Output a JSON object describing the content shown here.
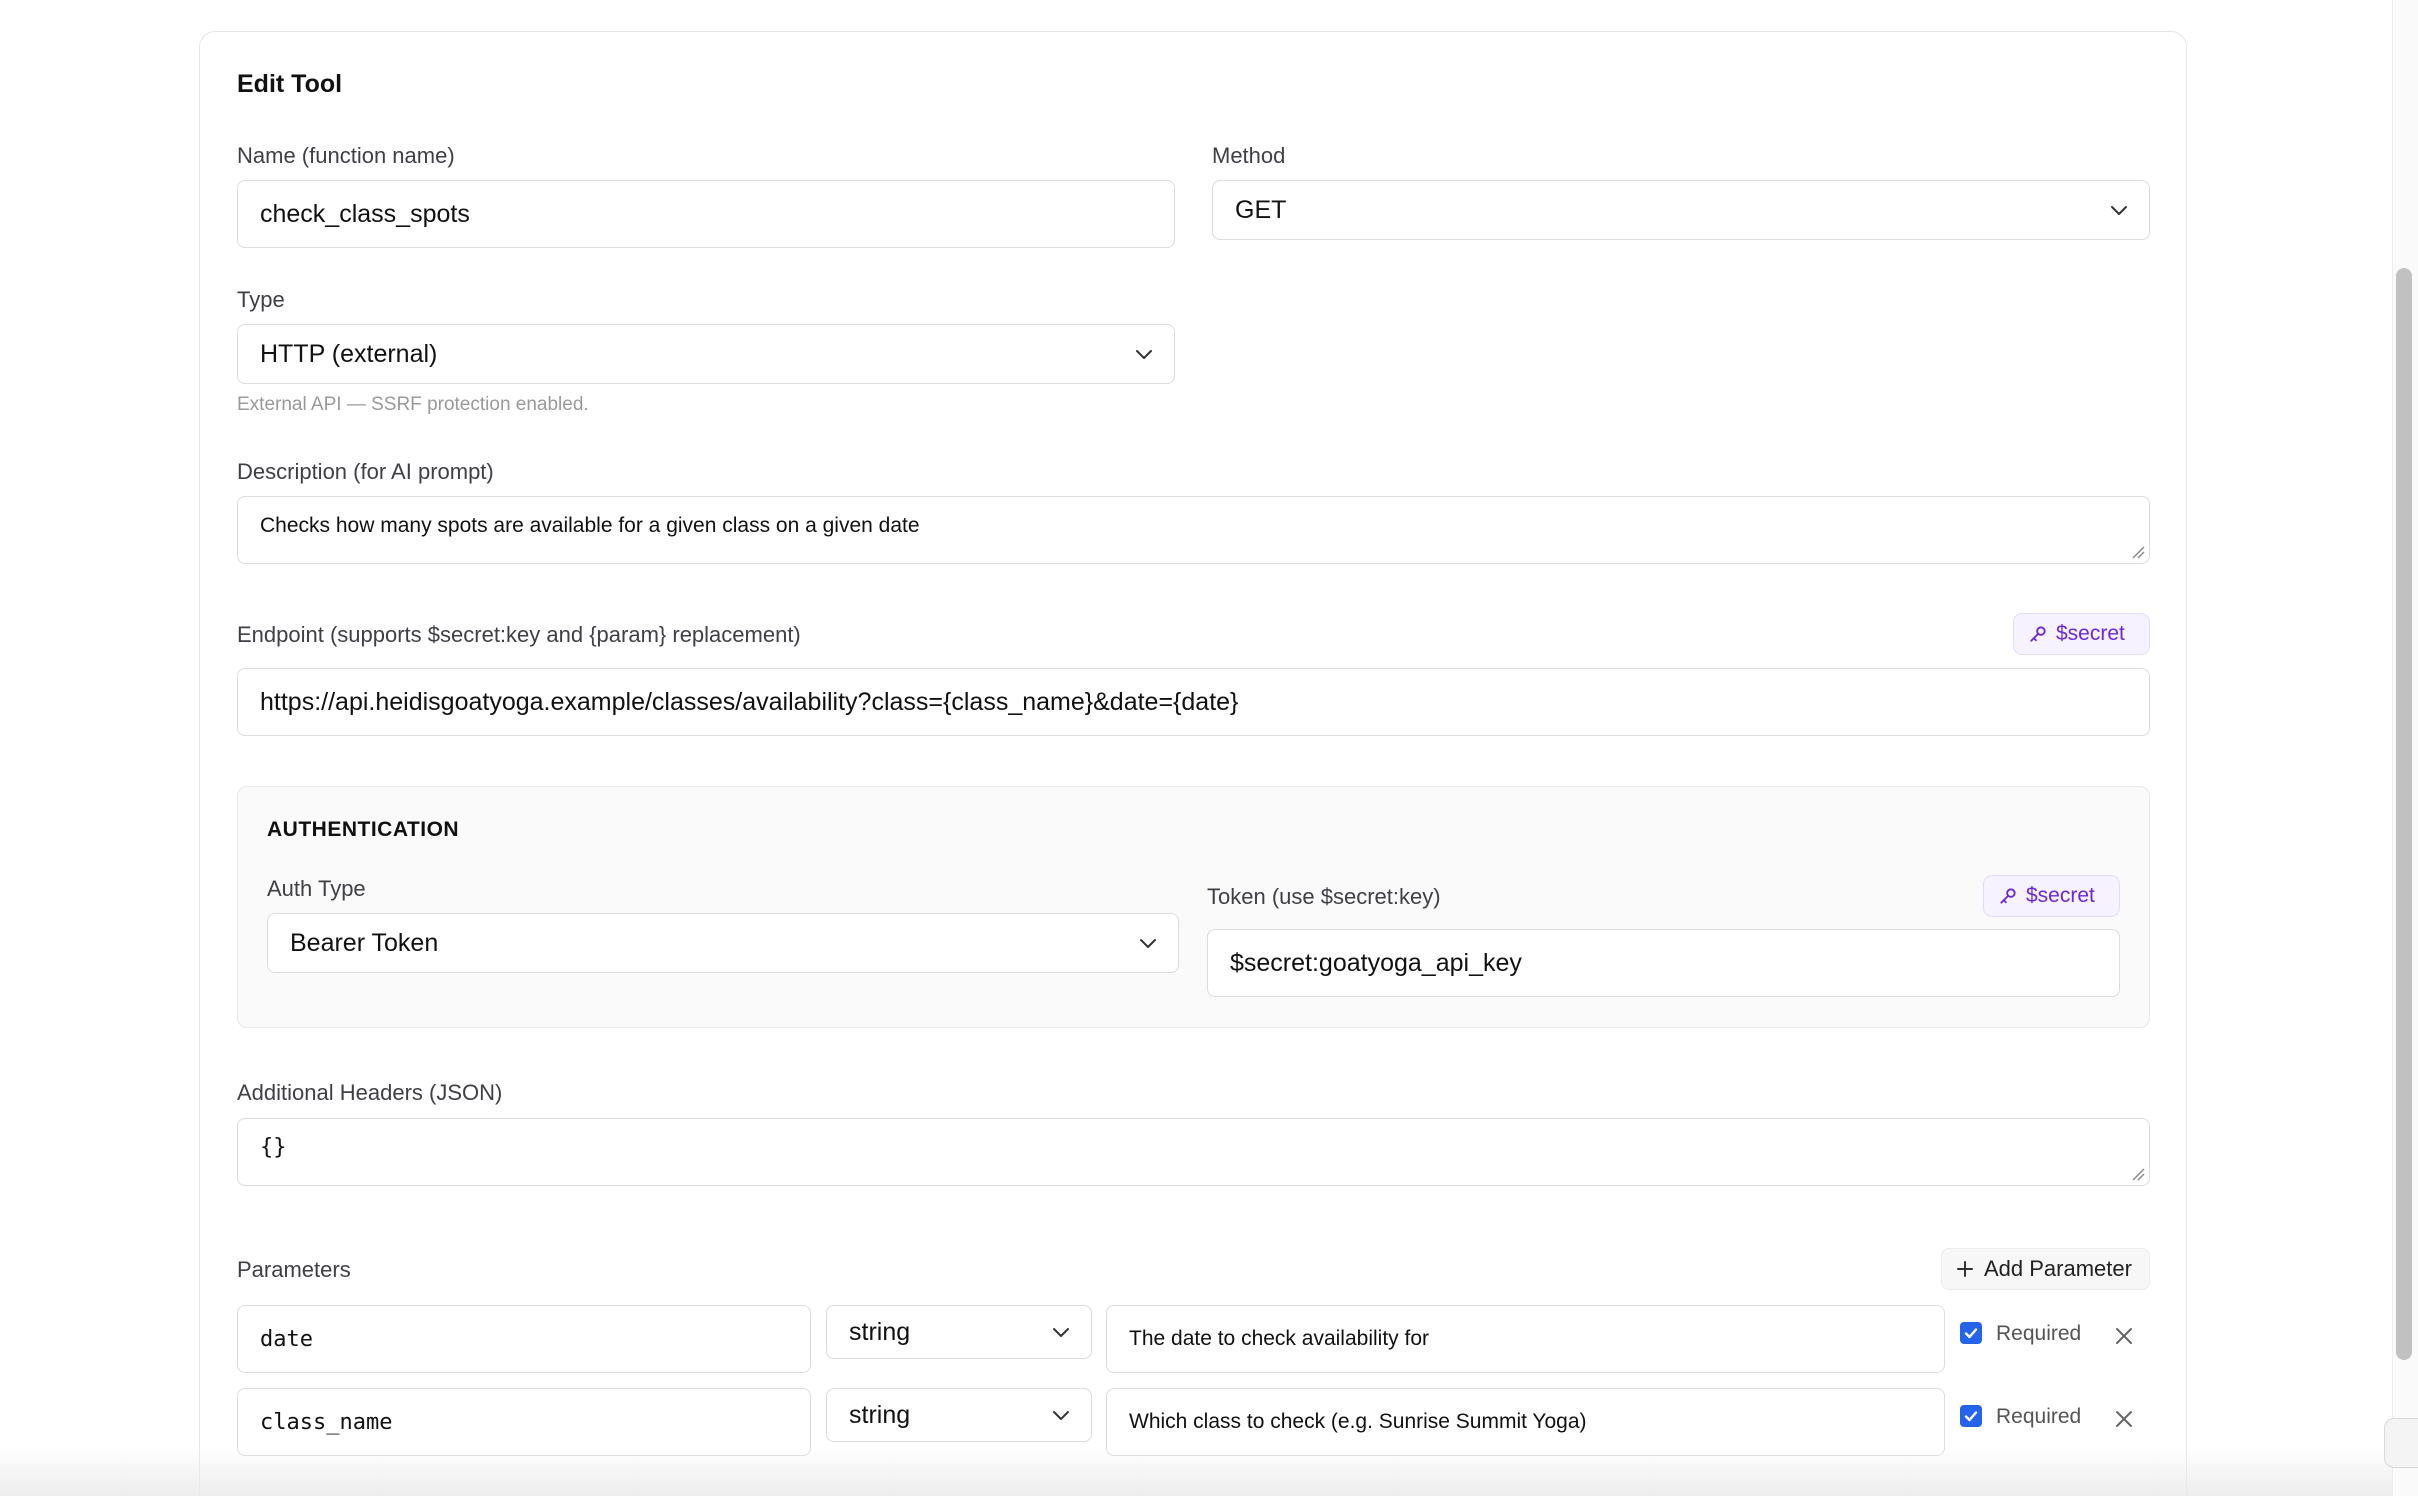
{
  "form": {
    "title": "Edit Tool",
    "name_label": "Name (function name)",
    "name_value": "check_class_spots",
    "method_label": "Method",
    "method_value": "GET",
    "type_label": "Type",
    "type_value": "HTTP (external)",
    "type_hint": "External API — SSRF protection enabled.",
    "description_label": "Description (for AI prompt)",
    "description_value": "Checks how many spots are available for a given class on a given date",
    "endpoint_label": "Endpoint (supports $secret:key and {param} replacement)",
    "endpoint_secret_button": "$secret",
    "endpoint_value": "https://api.heidisgoatyoga.example/classes/availability?class={class_name}&date={date}",
    "headers_label": "Additional Headers (JSON)",
    "headers_value": "{}"
  },
  "auth": {
    "title": "AUTHENTICATION",
    "type_label": "Auth Type",
    "type_value": "Bearer Token",
    "token_label": "Token (use $secret:key)",
    "token_secret_button": "$secret",
    "token_value": "$secret:goatyoga_api_key"
  },
  "parameters": {
    "label": "Parameters",
    "add_button": "Add Parameter",
    "rows": [
      {
        "name": "date",
        "type": "string",
        "description": "The date to check availability for",
        "required": true,
        "required_label": "Required"
      },
      {
        "name": "class_name",
        "type": "string",
        "description": "Which class to check (e.g. Sunrise Summit Yoga)",
        "required": true,
        "required_label": "Required"
      }
    ]
  },
  "icons": {
    "chevron": "chevron-down-icon",
    "key": "key-icon",
    "plus": "plus-icon",
    "close": "close-icon",
    "check": "check-icon"
  },
  "colors": {
    "accent_purple": "#6d28d9",
    "checkbox_blue": "#2563eb",
    "border": "#dcdcdc"
  }
}
